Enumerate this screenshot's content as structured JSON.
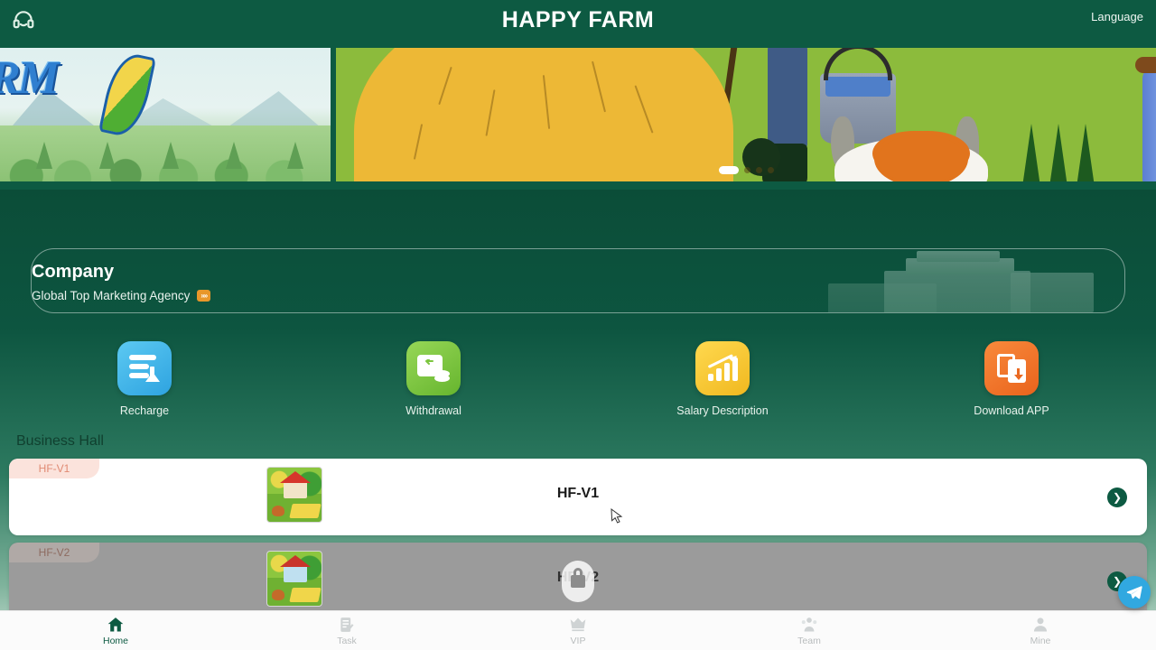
{
  "header": {
    "title": "HAPPY FARM",
    "language_label": "Language",
    "service_icon": "headset-icon"
  },
  "banner": {
    "left_logo_text": "RM",
    "carousel": {
      "total_dots": 4,
      "active_index": 0
    }
  },
  "company": {
    "title": "Company",
    "subtitle": "Global Top Marketing Agency",
    "badge": "»»"
  },
  "actions": [
    {
      "label": "Recharge",
      "icon": "recharge-icon",
      "color": "#37b0e8"
    },
    {
      "label": "Withdrawal",
      "icon": "withdrawal-icon",
      "color": "#7cc63f"
    },
    {
      "label": "Salary Description",
      "icon": "salary-chart-icon",
      "color": "#f5c431"
    },
    {
      "label": "Download APP",
      "icon": "download-app-icon",
      "color": "#ef7326"
    }
  ],
  "business_hall": {
    "section_title": "Business Hall",
    "cards": [
      {
        "badge": "HF-V1",
        "title": "HF-V1",
        "locked": false,
        "go_icon": "chevron-right-icon"
      },
      {
        "badge": "HF-V2",
        "title": "HF-V2",
        "locked": true,
        "lock_icon": "lock-icon"
      }
    ]
  },
  "float_button": {
    "name": "telegram-button",
    "icon": "telegram-icon",
    "color": "#31a8e0"
  },
  "bottom_nav": {
    "active": "Home",
    "items": [
      {
        "label": "Home",
        "icon": "home-icon"
      },
      {
        "label": "Task",
        "icon": "task-icon"
      },
      {
        "label": "VIP",
        "icon": "crown-icon"
      },
      {
        "label": "Team",
        "icon": "team-icon"
      },
      {
        "label": "Mine",
        "icon": "user-icon"
      }
    ]
  },
  "colors": {
    "header_bg": "#0d5a42",
    "page_bg": "#0a4433",
    "accent": "#0d5a42",
    "badge_pink": "#fbe3dc"
  }
}
